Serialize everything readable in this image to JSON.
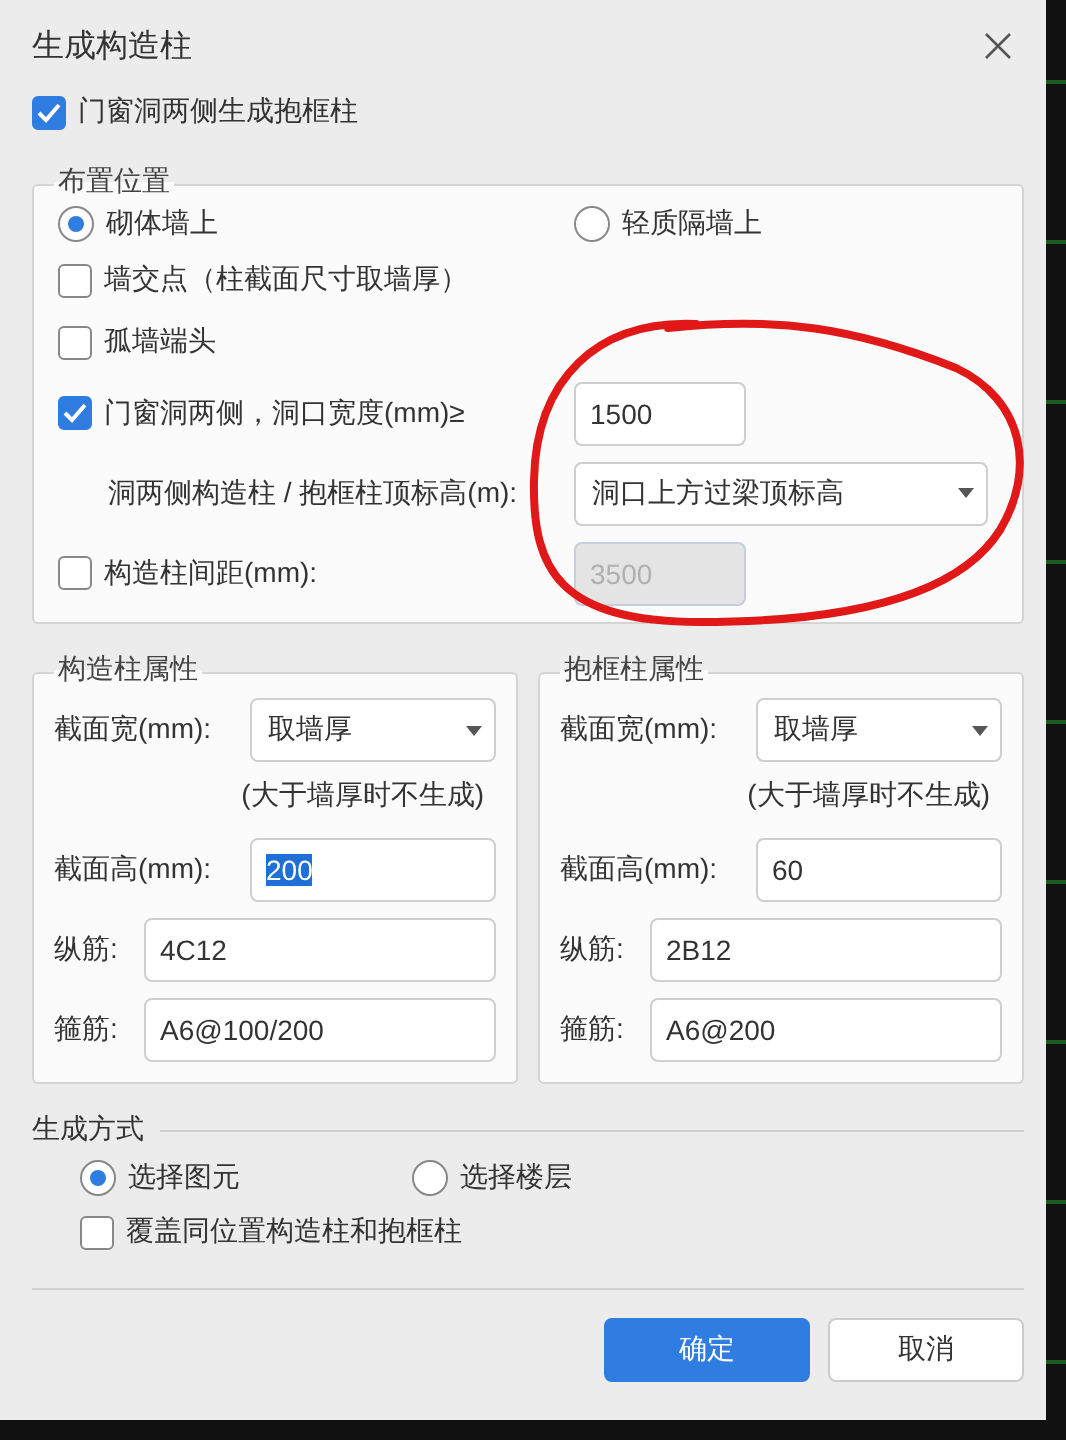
{
  "dialog": {
    "title": "生成构造柱"
  },
  "frame_checkbox": {
    "label": "门窗洞两侧生成抱框柱",
    "checked": true
  },
  "placement": {
    "title": "布置位置",
    "radios": [
      {
        "label": "砌体墙上",
        "selected": true
      },
      {
        "label": "轻质隔墙上",
        "selected": false
      }
    ],
    "rows": [
      {
        "kind": "check",
        "label": "墙交点（柱截面尺寸取墙厚）",
        "checked": false
      },
      {
        "kind": "check",
        "label": "孤墙端头",
        "checked": false
      },
      {
        "kind": "check-input",
        "label": "门窗洞两侧，洞口宽度(mm)≥",
        "checked": true,
        "value": "1500",
        "disabled": false
      },
      {
        "kind": "select",
        "label": "洞两侧构造柱 / 抱框柱顶标高(m):",
        "value": "洞口上方过梁顶标高"
      },
      {
        "kind": "check-input",
        "label": "构造柱间距(mm):",
        "checked": false,
        "value": "3500",
        "disabled": true
      }
    ]
  },
  "properties": [
    {
      "title": "构造柱属性",
      "fields": [
        {
          "kind": "select",
          "label": "截面宽(mm):",
          "value": "取墙厚"
        },
        {
          "kind": "note",
          "text": "(大于墙厚时不生成)"
        },
        {
          "kind": "input",
          "label": "截面高(mm):",
          "value": "200",
          "text_selected": true
        },
        {
          "kind": "input-wide",
          "label": "纵筋:",
          "value": "4C12",
          "text_selected": false
        },
        {
          "kind": "input-wide",
          "label": "箍筋:",
          "value": "A6@100/200",
          "text_selected": false
        }
      ]
    },
    {
      "title": "抱框柱属性",
      "fields": [
        {
          "kind": "select",
          "label": "截面宽(mm):",
          "value": "取墙厚"
        },
        {
          "kind": "note",
          "text": "(大于墙厚时不生成)"
        },
        {
          "kind": "input",
          "label": "截面高(mm):",
          "value": "60",
          "text_selected": false
        },
        {
          "kind": "input-wide",
          "label": "纵筋:",
          "value": "2B12",
          "text_selected": false
        },
        {
          "kind": "input-wide",
          "label": "箍筋:",
          "value": "A6@200",
          "text_selected": false
        }
      ]
    }
  ],
  "generation": {
    "title": "生成方式",
    "radios": [
      {
        "label": "选择图元",
        "selected": true
      },
      {
        "label": "选择楼层",
        "selected": false
      }
    ],
    "overwrite": {
      "label": "覆盖同位置构造柱和抱框柱",
      "checked": false
    }
  },
  "buttons": [
    {
      "label": "确定",
      "kind": "primary"
    },
    {
      "label": "取消",
      "kind": "secondary"
    }
  ],
  "annotation": {
    "kind": "circle"
  }
}
